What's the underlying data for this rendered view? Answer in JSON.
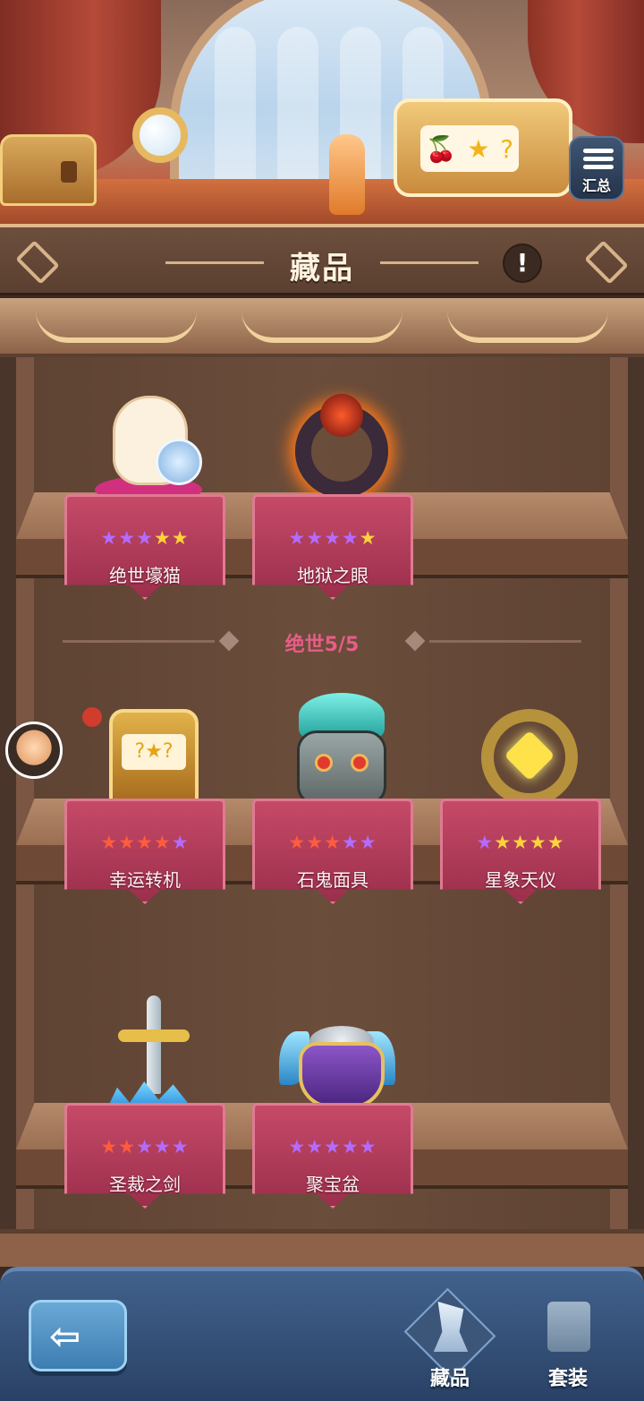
{
  "header": {
    "summary_label": "汇总",
    "title": "藏品",
    "info_label": "!"
  },
  "scene": {
    "slot_symbols": [
      "🍒",
      "★",
      "?"
    ]
  },
  "shelves": {
    "legendary_group": {
      "label": "绝世5/5",
      "items": [
        {
          "name": "绝世壕猫",
          "stars": [
            "purple",
            "purple",
            "purple",
            "gold",
            "gold"
          ],
          "icon": "lucky-cat-icon"
        },
        {
          "name": "地狱之眼",
          "stars": [
            "purple",
            "purple",
            "purple",
            "purple",
            "gold"
          ],
          "icon": "hell-eye-ring-icon"
        }
      ]
    },
    "other_items": [
      {
        "name": "幸运转机",
        "stars": [
          "red",
          "red",
          "red",
          "red",
          "purple"
        ],
        "icon": "slot-machine-icon",
        "slot_text": "?★?"
      },
      {
        "name": "石鬼面具",
        "stars": [
          "red",
          "red",
          "red",
          "purple",
          "purple"
        ],
        "icon": "stone-mask-icon"
      },
      {
        "name": "星象天仪",
        "stars": [
          "purple",
          "gold",
          "gold",
          "gold",
          "gold"
        ],
        "icon": "astrolabe-icon"
      },
      {
        "name": "圣裁之剑",
        "stars": [
          "red",
          "red",
          "purple",
          "purple",
          "purple"
        ],
        "icon": "judgement-sword-icon"
      },
      {
        "name": "聚宝盆",
        "stars": [
          "purple",
          "purple",
          "purple",
          "purple",
          "purple"
        ],
        "icon": "treasure-bowl-icon"
      }
    ]
  },
  "bottom_nav": {
    "back_label": "⇦",
    "tabs": [
      {
        "label": "藏品",
        "active": true,
        "icon": "collection-icon"
      },
      {
        "label": "套装",
        "active": false,
        "icon": "set-book-icon"
      }
    ]
  },
  "colors": {
    "star_gold": "#ffd23c",
    "star_red": "#ff5c3c",
    "star_purple": "#b26cff",
    "plaque": "#c54a68",
    "group_label": "#e75d86",
    "nav_bg": "#2a4166"
  }
}
